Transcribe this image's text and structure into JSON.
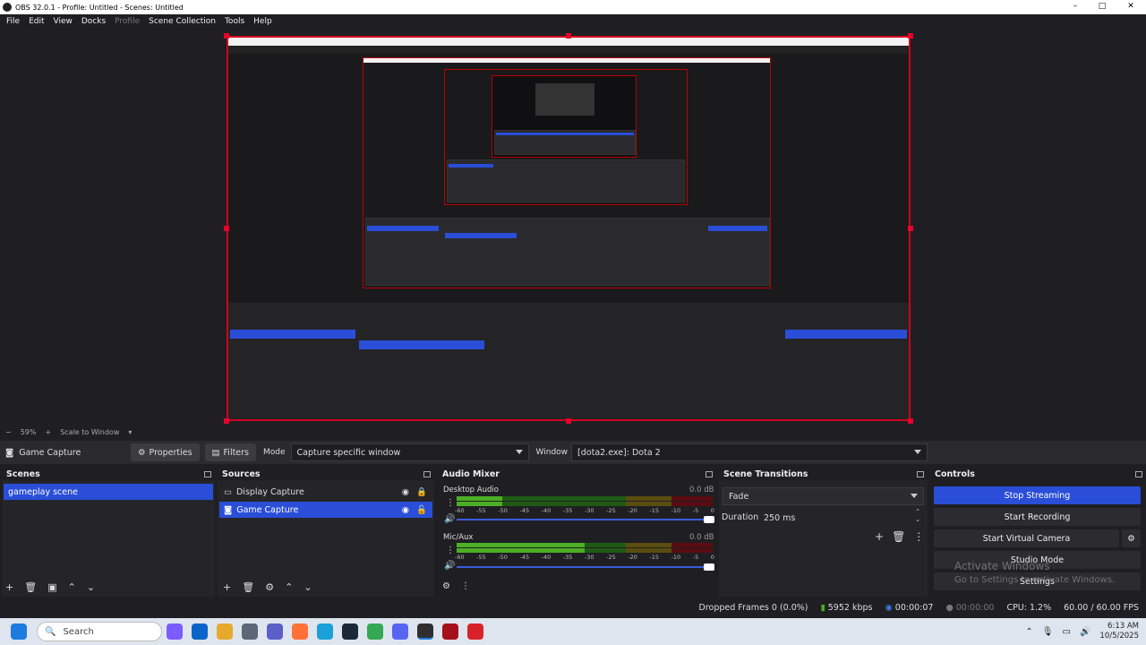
{
  "window": {
    "title": "OBS 32.0.1 - Profile: Untitled - Scenes: Untitled"
  },
  "menu": {
    "file": "File",
    "edit": "Edit",
    "view": "View",
    "docks": "Docks",
    "profile": "Profile",
    "scene_collection": "Scene Collection",
    "tools": "Tools",
    "help": "Help"
  },
  "preview": {
    "zoom": "59%",
    "scale_mode": "Scale to Window"
  },
  "source_toolbar": {
    "source_name": "Game Capture",
    "properties": "Properties",
    "filters": "Filters",
    "mode_label": "Mode",
    "mode_value": "Capture specific window",
    "window_label": "Window",
    "window_value": "[dota2.exe]: Dota 2"
  },
  "scenes": {
    "title": "Scenes",
    "items": [
      "gameplay scene"
    ]
  },
  "sources": {
    "title": "Sources",
    "items": [
      "Display Capture",
      "Game Capture"
    ]
  },
  "audio_mixer": {
    "title": "Audio Mixer",
    "ticks": [
      "-60",
      "-55",
      "-50",
      "-45",
      "-40",
      "-35",
      "-30",
      "-25",
      "-20",
      "-15",
      "-10",
      "-5",
      "0"
    ],
    "channels": [
      {
        "name": "Desktop Audio",
        "db": "0.0 dB",
        "level": 0.18,
        "volume": 1.0
      },
      {
        "name": "Mic/Aux",
        "db": "0.0 dB",
        "level": 0.5,
        "volume": 1.0
      }
    ]
  },
  "scene_transitions": {
    "title": "Scene Transitions",
    "transition": "Fade",
    "duration_label": "Duration",
    "duration_value": "250 ms"
  },
  "controls": {
    "title": "Controls",
    "stop_streaming": "Stop Streaming",
    "start_recording": "Start Recording",
    "start_virtual_camera": "Start Virtual Camera",
    "studio_mode": "Studio Mode",
    "settings": "Settings"
  },
  "watermark": {
    "line1": "Activate Windows",
    "line2": "Go to Settings to activate Windows."
  },
  "status": {
    "dropped_frames": "Dropped Frames 0 (0.0%)",
    "bitrate": "5952 kbps",
    "stream_time": "00:00:07",
    "rec_time": "00:00:00",
    "cpu": "CPU: 1.2%",
    "fps": "60.00 / 60.00 FPS"
  },
  "taskbar": {
    "search_placeholder": "Search",
    "time": "6:13 AM",
    "date": "10/5/2025"
  },
  "colors": {
    "accent": "#2a4ed8",
    "preview_border": "#d0001c",
    "meter_green": "#4caf24",
    "meter_yellow": "#b8a020",
    "meter_red": "#b01020"
  }
}
